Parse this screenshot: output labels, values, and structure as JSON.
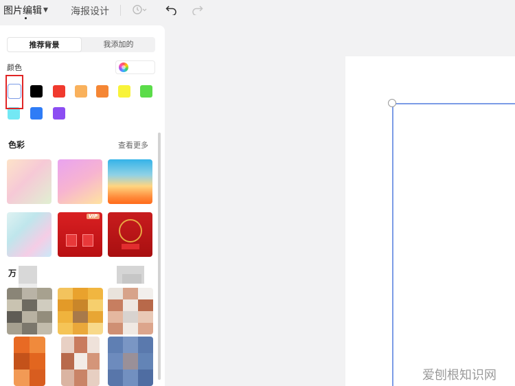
{
  "topbar": {
    "menu_image_edit": "图片编辑",
    "menu_poster_design": "海报设计",
    "icons": [
      "history-icon",
      "undo-icon",
      "redo-icon"
    ]
  },
  "panel": {
    "tabs": [
      {
        "label": "推荐背景",
        "active": true
      },
      {
        "label": "我添加的",
        "active": false
      }
    ],
    "color_label": "颜色",
    "swatches": [
      "#ffffff",
      "#000000",
      "#f03a2e",
      "#f9b15c",
      "#f58634",
      "#f8f33a",
      "#5bdc4a",
      "#73e8f4",
      "#2f7cf6",
      "#8c4df2"
    ],
    "section_colors": {
      "title": "色彩",
      "more": "查看更多"
    },
    "section_third_title_partial": "万",
    "vip_badge": "VIP"
  },
  "watermark": "爱刨根知识网"
}
